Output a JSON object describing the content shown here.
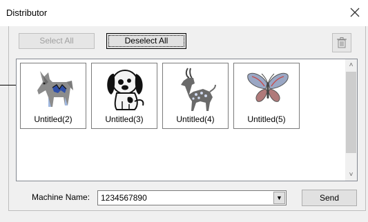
{
  "window": {
    "title": "Distributor"
  },
  "toolbar": {
    "select_all_label": "Select All",
    "deselect_all_label": "Deselect All"
  },
  "items": [
    {
      "label": "Untitled(2)",
      "icon": "horse-embroidery-icon"
    },
    {
      "label": "Untitled(3)",
      "icon": "puppy-embroidery-icon"
    },
    {
      "label": "Untitled(4)",
      "icon": "antelope-embroidery-icon"
    },
    {
      "label": "Untitled(5)",
      "icon": "butterfly-embroidery-icon"
    }
  ],
  "machine": {
    "label": "Machine Name:",
    "value": "1234567890"
  },
  "send_label": "Send",
  "icons": {
    "close": "close-icon",
    "trash": "trash-icon",
    "scroll_up": "scroll-up-icon",
    "scroll_down": "scroll-down-icon",
    "dropdown": "dropdown-arrow-icon"
  }
}
